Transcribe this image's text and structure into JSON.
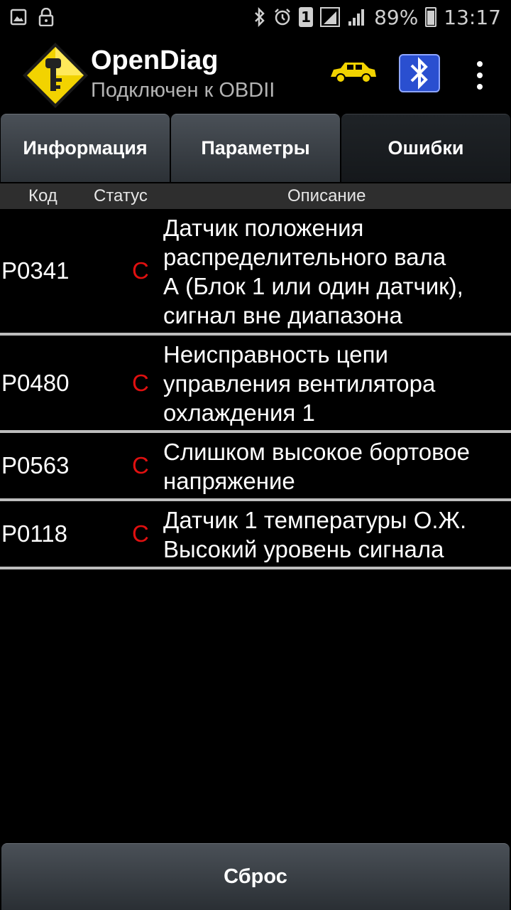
{
  "statusbar": {
    "battery": "89%",
    "time": "13:17",
    "sim": "1",
    "icons": [
      "gallery-icon",
      "lock-icon",
      "bluetooth-icon",
      "alarm-icon",
      "sim-icon",
      "signal-icon",
      "signal-icon",
      "battery-icon"
    ]
  },
  "app": {
    "title": "OpenDiag",
    "subtitle": "Подключен к OBDII",
    "accent": "#f2d300"
  },
  "tabs": [
    {
      "label": "Информация",
      "active": false
    },
    {
      "label": "Параметры",
      "active": false
    },
    {
      "label": "Ошибки",
      "active": true
    }
  ],
  "columns": {
    "code": "Код",
    "status": "Статус",
    "description": "Описание"
  },
  "errors": [
    {
      "code": "P0341",
      "status": "C",
      "description_lines": [
        "Датчик положения",
        "распределительного вала",
        "А (Блок 1 или один датчик),",
        "сигнал вне диапазона"
      ]
    },
    {
      "code": "P0480",
      "status": "C",
      "description_lines": [
        "Неисправность цепи",
        "управления вентилятора",
        "охлаждения 1"
      ]
    },
    {
      "code": "P0563",
      "status": "C",
      "description_lines": [
        "Слишком высокое бортовое",
        "напряжение"
      ]
    },
    {
      "code": "P0118",
      "status": "C",
      "description_lines": [
        "Датчик 1 температуры О.Ж.",
        "Высокий уровень сигнала"
      ]
    }
  ],
  "reset_button": "Сброс"
}
